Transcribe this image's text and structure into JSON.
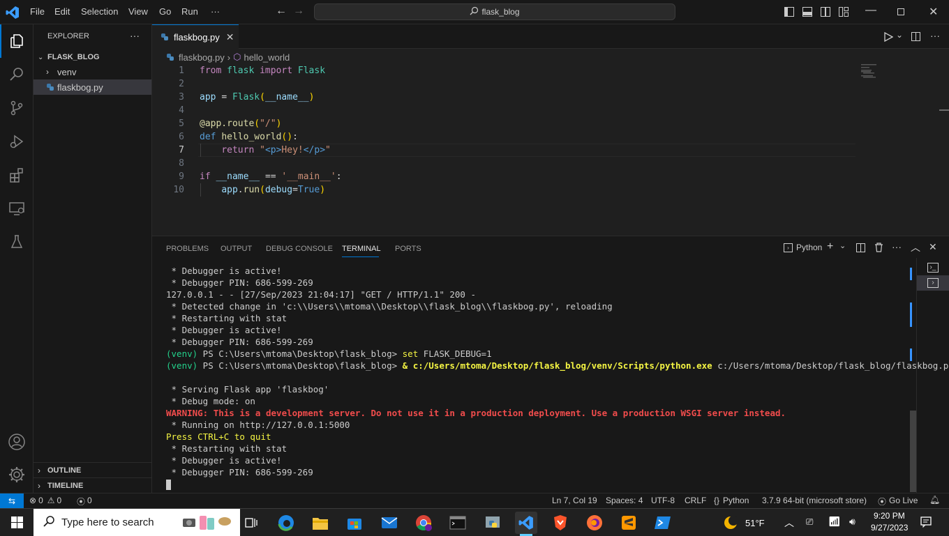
{
  "menu": [
    "File",
    "Edit",
    "Selection",
    "View",
    "Go",
    "Run",
    "···"
  ],
  "search": {
    "text": "flask_blog"
  },
  "explorer": {
    "title": "EXPLORER",
    "more": "···",
    "root": "FLASK_BLOG",
    "items": [
      "venv",
      "flaskbog.py"
    ],
    "outline": "OUTLINE",
    "timeline": "TIMELINE"
  },
  "editor": {
    "tab": "flaskbog.py",
    "breadcrumb": {
      "file": "flaskbog.py",
      "symbol": "hello_world"
    },
    "line_numbers": [
      "1",
      "2",
      "3",
      "4",
      "5",
      "6",
      "7",
      "8",
      "9",
      "10"
    ]
  },
  "panel": {
    "tabs": [
      "PROBLEMS",
      "OUTPUT",
      "DEBUG CONSOLE",
      "TERMINAL",
      "PORTS"
    ],
    "active": "TERMINAL",
    "shell": "Python"
  },
  "terminal": [
    " * Debugger is active!",
    " * Debugger PIN: 686-599-269",
    "127.0.0.1 - - [27/Sep/2023 21:04:17] \"GET / HTTP/1.1\" 200 -",
    " * Detected change in 'c:\\\\Users\\\\mtoma\\\\Desktop\\\\flask_blog\\\\flaskbog.py', reloading",
    " * Restarting with stat",
    " * Debugger is active!",
    " * Debugger PIN: 686-599-269",
    {
      "venv": "(venv)",
      "prompt": " PS C:\\Users\\mtoma\\Desktop\\flask_blog> ",
      "cmd": "set",
      "args": " FLASK_DEBUG=1"
    },
    {
      "venv": "(venv)",
      "prompt": " PS C:\\Users\\mtoma\\Desktop\\flask_blog> ",
      "cmd": "& c:/Users/mtoma/Desktop/flask_blog/venv/Scripts/python.exe",
      "args": " c:/Users/mtoma/Desktop/flask_blog/flaskbog.py"
    },
    "",
    " * Serving Flask app 'flaskbog'",
    " * Debug mode: on",
    "WARNING: This is a development server. Do not use it in a production deployment. Use a production WSGI server instead.",
    " * Running on http://127.0.0.1:5000",
    "Press CTRL+C to quit",
    " * Restarting with stat",
    " * Debugger is active!",
    " * Debugger PIN: 686-599-269"
  ],
  "status": {
    "errors": "0",
    "warnings": "0",
    "ports": "0",
    "position": "Ln 7, Col 19",
    "spaces": "Spaces: 4",
    "encoding": "UTF-8",
    "eol": "CRLF",
    "language": "Python",
    "interpreter": "3.7.9 64-bit (microsoft store)",
    "golive": "Go Live"
  },
  "taskbar": {
    "search_placeholder": "Type here to search",
    "weather": "51°F",
    "time": "9:20 PM",
    "date": "9/27/2023"
  },
  "colors": {
    "accent": "#0078d4",
    "warning": "#f14c4c",
    "prompt": "#23d18b"
  }
}
